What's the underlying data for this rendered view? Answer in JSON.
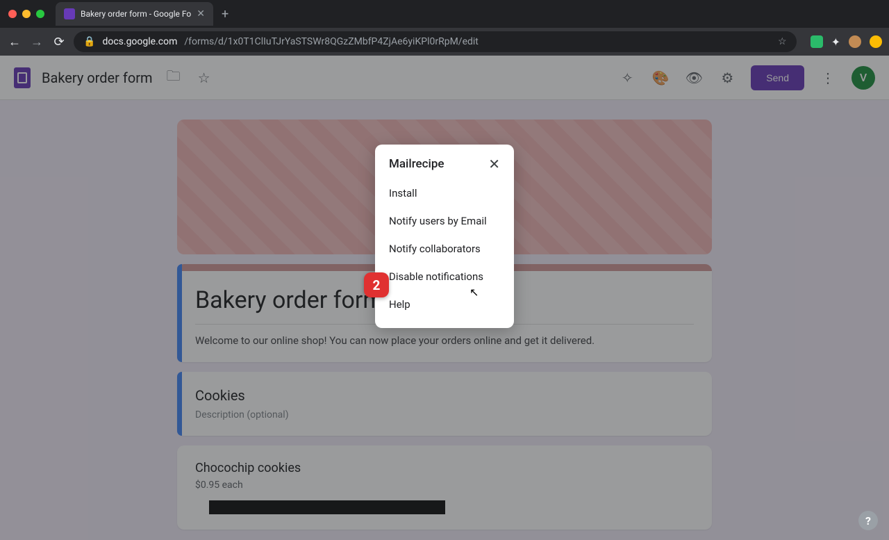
{
  "browser": {
    "tab_title": "Bakery order form - Google Fo",
    "url_host": "docs.google.com",
    "url_path": "/forms/d/1x0T1ClIuTJrYaSTSWr8QGzZMbfP4ZjAe6yiKPl0rRpM/edit"
  },
  "header": {
    "doc_title": "Bakery order form",
    "send_label": "Send",
    "avatar_initial": "V"
  },
  "form": {
    "title": "Bakery order form",
    "description": "Welcome to our online shop! You can now place your orders online and get it delivered.",
    "section_title": "Cookies",
    "section_desc": "Description (optional)",
    "q1_title": "Chocochip cookies",
    "q1_sub": "$0.95 each"
  },
  "popup": {
    "title": "Mailrecipe",
    "items": [
      "Install",
      "Notify users by Email",
      "Notify collaborators",
      "Disable notifications",
      "Help"
    ]
  },
  "badge": {
    "value": "2"
  },
  "help_label": "?"
}
